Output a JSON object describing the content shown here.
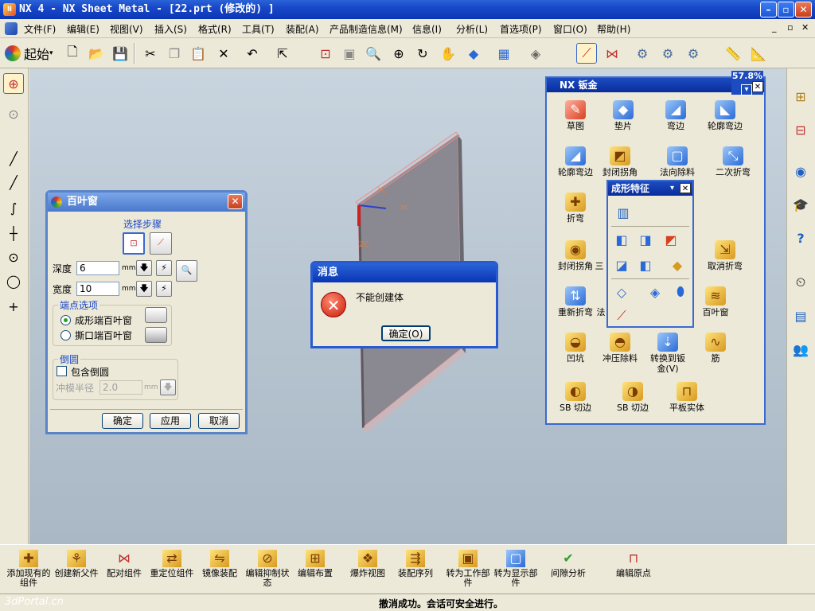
{
  "window": {
    "title": "NX 4 - NX Sheet Metal - [22.prt  (修改的) ]"
  },
  "menu": [
    "文件(F)",
    "编辑(E)",
    "视图(V)",
    "插入(S)",
    "格式(R)",
    "工具(T)",
    "装配(A)",
    "产品制造信息(M)",
    "信息(I)",
    "分析(L)",
    "首选项(P)",
    "窗口(O)",
    "帮助(H)"
  ],
  "toolbar": {
    "start_label": "起始"
  },
  "louver_dialog": {
    "title": "百叶窗",
    "select_steps_label": "选择步骤",
    "depth_label": "深度",
    "depth_value": "6",
    "width_label": "宽度",
    "width_value": "10",
    "unit": "mm",
    "end_options_label": "端点选项",
    "option_formed": "成形端百叶窗",
    "option_lanced": "撕口端百叶窗",
    "fillet_group_label": "倒圆",
    "include_fillet_label": "包含倒圆",
    "punch_radius_label": "冲模半径",
    "punch_radius_value": "2.0",
    "ok_label": "确定",
    "apply_label": "应用",
    "cancel_label": "取消"
  },
  "message_dialog": {
    "title": "消息",
    "text": "不能创建体",
    "ok_label": "确定(O)"
  },
  "sheetmetal_palette": {
    "title": "NX 钣金",
    "percent": "57.8%",
    "items": [
      "草图",
      "垫片",
      "弯边",
      "轮廓弯边",
      "轮廓弯边",
      "封闭拐角",
      "法向除料",
      "二次折弯",
      "折弯",
      "封闭拐角",
      "三",
      "取消折弯",
      "重新折弯",
      "法",
      "百叶窗",
      "凹坑",
      "冲压除料",
      "转换到钣金(V)",
      "筋",
      "SB 切边",
      "SB 切边",
      "平板实体"
    ]
  },
  "forming_palette": {
    "title": "成形特征"
  },
  "assembly_toolbar": [
    "添加现有的组件",
    "创建新父件",
    "配对组件",
    "重定位组件",
    "镜像装配",
    "编辑抑制状态",
    "编辑布置",
    "爆炸视图",
    "装配序列",
    "转为工作部件",
    "转为显示部件",
    "间隙分析",
    "编辑原点"
  ],
  "status": {
    "text": "撤消成功。会话可安全进行。"
  },
  "watermark": "3dPortal.cn"
}
